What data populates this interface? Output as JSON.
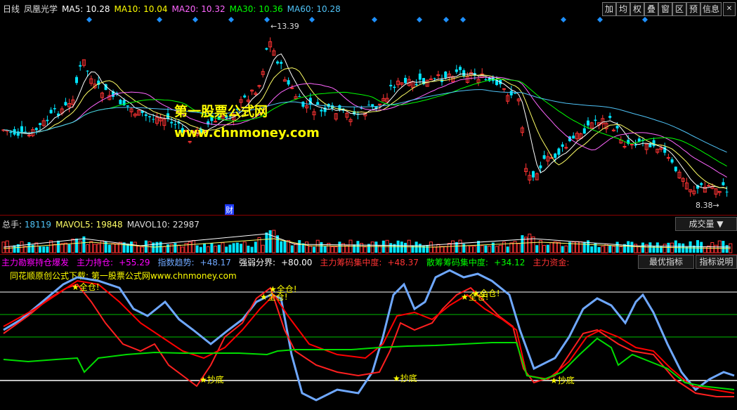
{
  "header": {
    "period": "日线",
    "stock_name": "凤凰光学",
    "ma": [
      {
        "label": "MA5:",
        "value": "10.28",
        "color": "#ffffff"
      },
      {
        "label": "MA10:",
        "value": "10.04",
        "color": "#ffff00"
      },
      {
        "label": "MA20:",
        "value": "10.32",
        "color": "#ff66ff"
      },
      {
        "label": "MA30:",
        "value": "10.36",
        "color": "#00ff00"
      },
      {
        "label": "MA60:",
        "value": "10.28",
        "color": "#4fc3f7"
      }
    ],
    "toolbar": [
      "加",
      "均",
      "权",
      "叠",
      "窗",
      "区",
      "预",
      "信息"
    ]
  },
  "price_chart": {
    "high_label": "13.39",
    "low_label": "8.38",
    "finance_marker": "财",
    "watermark_title": "第一股票公式网",
    "watermark_url": "www.chnmoney.com"
  },
  "volume": {
    "label": "总手:",
    "value": "18119",
    "mavol5_label": "MAVOL5:",
    "mavol5": "19848",
    "mavol10_label": "MAVOL10:",
    "mavol10": "22987",
    "dropdown": "成交量"
  },
  "indicator": {
    "items": [
      {
        "label": "主力勘察持仓爆发",
        "value": "",
        "color": "#ff00ff"
      },
      {
        "label": "主力持仓:",
        "value": "+55.29",
        "color": "#ff00ff"
      },
      {
        "label": "指数趋势:",
        "value": "+48.17",
        "color": "#6fa8ff"
      },
      {
        "label": "强弱分界:",
        "value": "+80.00",
        "color": "#ffffff"
      },
      {
        "label": "主力筹码集中度:",
        "value": "+48.37",
        "color": "#ff3333"
      },
      {
        "label": "散筹筹码集中度:",
        "value": "+34.12",
        "color": "#00ff00"
      },
      {
        "label": "主力资金:",
        "value": "",
        "color": "#ff3333"
      }
    ],
    "btn_optimal": "最优指标",
    "btn_help": "指标说明",
    "subtitle": "同花顺原创公式下载: 第一股票公式网www.chnmoney.com",
    "markers": {
      "full": "★全仓!",
      "bottom": "★抄底"
    }
  },
  "colors": {
    "up": "#ff3333",
    "down": "#00e5ff",
    "background": "#000000",
    "blue_line": "#6fa8ff",
    "red_line": "#ff2020",
    "green_line": "#00dd00"
  }
}
